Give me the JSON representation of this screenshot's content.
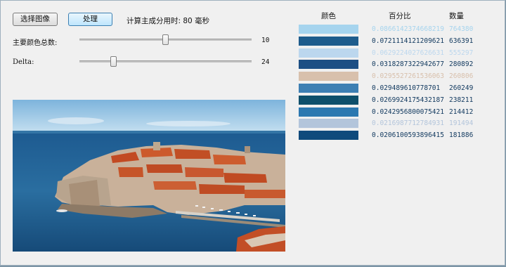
{
  "toolbar": {
    "select_image_label": "选择图像",
    "process_label": "处理",
    "timing_label": "计算主成分用时: 80 毫秒"
  },
  "controls": {
    "main_colors": {
      "label": "主要颜色总数:",
      "value": "10",
      "fraction": 0.5
    },
    "delta": {
      "label": "Delta:",
      "value": "24",
      "fraction": 0.2
    }
  },
  "table": {
    "headers": {
      "color": "颜色",
      "percent": "百分比",
      "count": "数量"
    },
    "rows": [
      {
        "color": "#a6d4ee",
        "percent": "0.0866142374668219",
        "count": "764380"
      },
      {
        "color": "#1e5c8c",
        "percent": "0.0721114121209621",
        "count": "636391"
      },
      {
        "color": "#bcd7ee",
        "percent": "0.0629224027626631",
        "count": "555297"
      },
      {
        "color": "#1d4f84",
        "percent": "0.0318287322942677",
        "count": "280892"
      },
      {
        "color": "#d8c0ac",
        "percent": "0.0295527261536063",
        "count": "260806"
      },
      {
        "color": "#3d7fb3",
        "percent": "0.029489610778701",
        "count": "260249"
      },
      {
        "color": "#0e4f6b",
        "percent": "0.0269924175432187",
        "count": "238211"
      },
      {
        "color": "#2c78b0",
        "percent": "0.0242956800075421",
        "count": "214412"
      },
      {
        "color": "#b3c5db",
        "percent": "0.0216987712784931",
        "count": "191494"
      },
      {
        "color": "#0f4a7c",
        "percent": "0.0206100593896415",
        "count": "181886"
      }
    ]
  },
  "image": {
    "description_icon": "photo-dubrovnik"
  }
}
